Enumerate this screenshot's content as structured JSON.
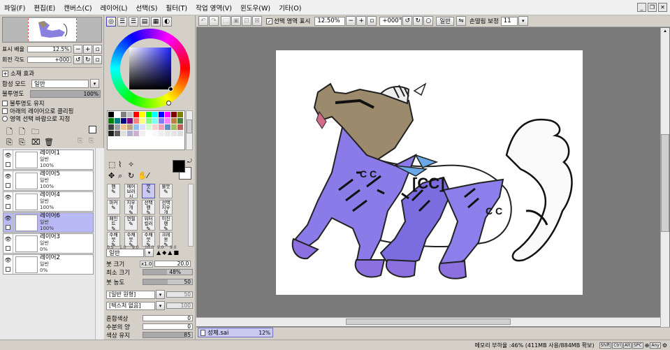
{
  "menu": {
    "items": [
      "파일(F)",
      "편집(E)",
      "캔버스(C)",
      "레이어(L)",
      "선택(S)",
      "필터(T)",
      "작업 영역(V)",
      "윈도우(W)",
      "기타(O)"
    ]
  },
  "navigator": {
    "zoom_label": "표시 배율",
    "zoom_value": "12.5%",
    "rotate_label": "회전 각도",
    "rotate_value": "+000"
  },
  "layer_panel": {
    "effects_label": "소재 효과",
    "blend_label": "합성 모드",
    "blend_value": "일반",
    "opacity_label": "불투명도",
    "opacity_value": "100%",
    "opacity": 1.0,
    "check_preserve": "불투명도 유지",
    "check_clip": "아래의 레이어으로 클리핑",
    "check_select": "영역 선택 바람으로 지정",
    "layers": [
      {
        "name": "레이어1",
        "mode": "일반",
        "opacity": "100%",
        "selected": false
      },
      {
        "name": "레이어5",
        "mode": "일반",
        "opacity": "100%",
        "selected": false
      },
      {
        "name": "레이어4",
        "mode": "일반",
        "opacity": "100%",
        "selected": false
      },
      {
        "name": "레이어6",
        "mode": "일반",
        "opacity": "100%",
        "selected": true
      },
      {
        "name": "레이어3",
        "mode": "일반",
        "opacity": "0%",
        "selected": false
      },
      {
        "name": "레이어2",
        "mode": "일반",
        "opacity": "0%",
        "selected": false
      }
    ]
  },
  "tools": {
    "row1": [
      "펜",
      "에어브러시",
      "붓",
      "물붓"
    ],
    "row2": [
      "마커",
      "지우개",
      "선택펜",
      "선택지우개"
    ],
    "row3": [
      "페인트",
      "연필",
      "워터컬러",
      "이진펜"
    ],
    "row4": [
      "수채붓",
      "수채붓",
      "수채붓",
      "크레용"
    ],
    "sub_labels": [
      "0.5",
      "1.0",
      "9.0",
      "10.0",
      "9.0",
      "9.0"
    ]
  },
  "brush": {
    "mode_value": "일반",
    "size_label": "붓 크기",
    "size_mult": "x1.0",
    "size_value": "20.0",
    "min_label": "최소 크기",
    "min_value": "48%",
    "min_fraction": 0.48,
    "density_label": "붓 농도",
    "density_value": "50",
    "density_fraction": 0.5,
    "shape_value": "[일반 원형]",
    "shape_amount": "50",
    "texture_value": "[텍스처 없음]",
    "texture_amount": "100",
    "blend_label": "혼합색상",
    "blend_value": "0",
    "water_label": "수분의 양",
    "water_value": "0",
    "persist_label": "색상 유지",
    "persist_value": "85",
    "persist_fraction": 0.85
  },
  "toolbar": {
    "selection_label": "선택 영역 표시",
    "zoom_value": "12.50%",
    "rotate_value": "+000°",
    "mode_value": "일반",
    "stabilizer_label": "손떨림 보정",
    "stabilizer_value": "11"
  },
  "document_tab": {
    "name": "성체.sai",
    "zoom": "12%"
  },
  "status": {
    "memory": "메모리 부하율 :46% (411MB 사용/884MB 확보)",
    "keys": [
      "Shift",
      "Ctrl",
      "Alt",
      "SPC",
      "Any"
    ]
  },
  "colors": {
    "accent": "#c9c9f2",
    "primary": "#000000",
    "secondary": "#ffffff",
    "canvas_bg": "#7a7a7a"
  }
}
